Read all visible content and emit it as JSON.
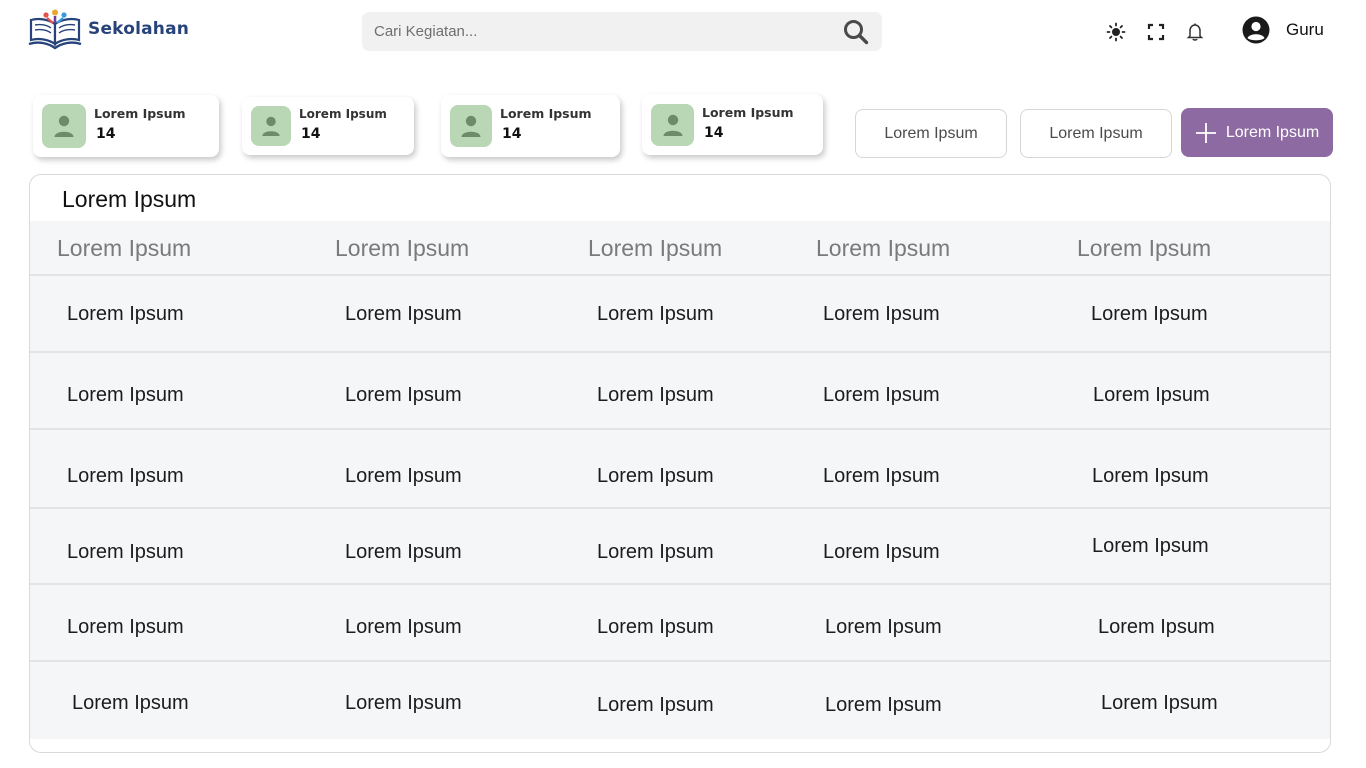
{
  "brand": {
    "name": "Sekolahan"
  },
  "search": {
    "placeholder": "Cari Kegiatan..."
  },
  "header": {
    "icons": [
      "theme-toggle-icon",
      "fullscreen-icon",
      "bell-icon",
      "user-avatar-icon"
    ],
    "user_name": "Guru"
  },
  "stats": [
    {
      "label": "Lorem Ipsum",
      "value": "14"
    },
    {
      "label": "Lorem Ipsum",
      "value": "14"
    },
    {
      "label": "Lorem Ipsum",
      "value": "14"
    },
    {
      "label": "Lorem Ipsum",
      "value": "14"
    }
  ],
  "actions": {
    "button_1": "Lorem Ipsum",
    "button_2": "Lorem Ipsum",
    "add_button": "Lorem Ipsum"
  },
  "table": {
    "title": "Lorem Ipsum",
    "headers": [
      "Lorem Ipsum",
      "Lorem Ipsum",
      "Lorem Ipsum",
      "Lorem Ipsum",
      "Lorem Ipsum"
    ],
    "rows": [
      [
        "Lorem Ipsum",
        "Lorem Ipsum",
        "Lorem Ipsum",
        "Lorem Ipsum",
        "Lorem Ipsum"
      ],
      [
        "Lorem Ipsum",
        "Lorem Ipsum",
        "Lorem Ipsum",
        "Lorem Ipsum",
        "Lorem Ipsum"
      ],
      [
        "Lorem Ipsum",
        "Lorem Ipsum",
        "Lorem Ipsum",
        "Lorem Ipsum",
        "Lorem Ipsum"
      ],
      [
        "Lorem Ipsum",
        "Lorem Ipsum",
        "Lorem Ipsum",
        "Lorem Ipsum",
        "Lorem Ipsum"
      ],
      [
        "Lorem Ipsum",
        "Lorem Ipsum",
        "Lorem Ipsum",
        "Lorem Ipsum",
        "Lorem Ipsum"
      ],
      [
        "Lorem Ipsum",
        "Lorem Ipsum",
        "Lorem Ipsum",
        "Lorem Ipsum",
        "Lorem Ipsum"
      ]
    ]
  },
  "colors": {
    "brand_text": "#27437a",
    "primary_button": "#8e6aa2",
    "avatar_bg": "#b9d6b5",
    "table_bg": "#f5f6f8"
  }
}
